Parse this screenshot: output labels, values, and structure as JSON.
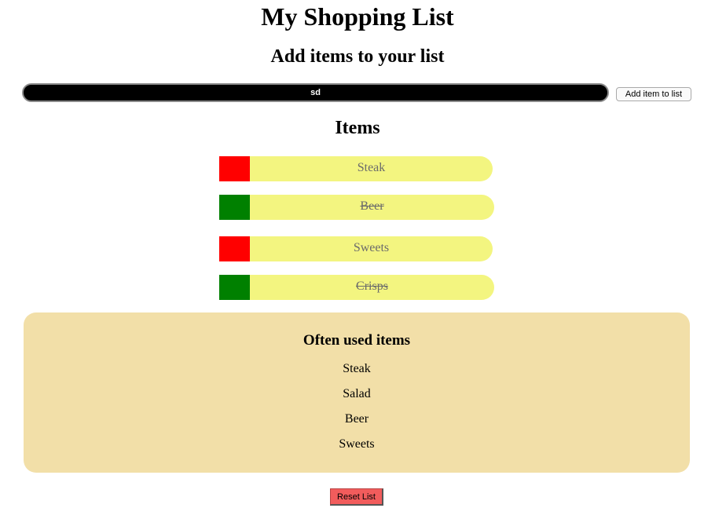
{
  "header": {
    "title": "My Shopping List",
    "subtitle": "Add items to your list"
  },
  "add_form": {
    "input_value": "sd",
    "add_button_label": "Add item to list"
  },
  "items_section": {
    "heading": "Items",
    "items": [
      {
        "label": "Steak",
        "status_color": "#ff0000",
        "crossed_out": false
      },
      {
        "label": "Beer",
        "status_color": "#008000",
        "crossed_out": true
      },
      {
        "label": "Sweets",
        "status_color": "#ff0000",
        "crossed_out": false
      },
      {
        "label": "Crisps",
        "status_color": "#008000",
        "crossed_out": true
      }
    ]
  },
  "often_used": {
    "title": "Often used items",
    "items": [
      "Steak",
      "Salad",
      "Beer",
      "Sweets"
    ]
  },
  "footer": {
    "reset_button_label": "Reset List"
  },
  "colors": {
    "item_bar": "#f3f580",
    "often_box": "#f2dfa8",
    "reset_button": "#f25c5c"
  }
}
